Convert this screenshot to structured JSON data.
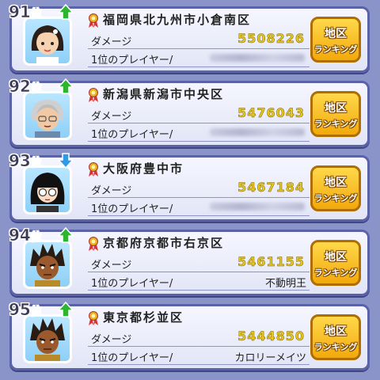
{
  "colors": {
    "trend_up": "#2db52d",
    "trend_down": "#2e9be6",
    "score": "#e8c81e",
    "button": "#f5b918"
  },
  "labels": {
    "damage": "ダメージ",
    "first_player": "1位のプレイヤー/",
    "button_line1": "地区",
    "button_line2": "ランキング",
    "rank_suffix": "位"
  },
  "rows": [
    {
      "rank": "91",
      "trend": "up",
      "trend_icon": "arrow-up-icon",
      "region": "福岡県北九州市小倉南区",
      "damage": "5508226",
      "player": "",
      "player_blurred": true,
      "avatar_icon": "girl-avatar-icon"
    },
    {
      "rank": "92",
      "trend": "up",
      "trend_icon": "arrow-up-icon",
      "region": "新潟県新潟市中央区",
      "damage": "5476043",
      "player": "",
      "player_blurred": true,
      "avatar_icon": "old-man-avatar-icon"
    },
    {
      "rank": "93",
      "trend": "down",
      "trend_icon": "arrow-down-icon",
      "region": "大阪府豊中市",
      "damage": "5467184",
      "player": "",
      "player_blurred": true,
      "avatar_icon": "glasses-girl-avatar-icon"
    },
    {
      "rank": "94",
      "trend": "up",
      "trend_icon": "arrow-up-icon",
      "region": "京都府京都市右京区",
      "damage": "5461155",
      "player": "不動明王",
      "player_blurred": false,
      "avatar_icon": "spiky-hair-avatar-icon"
    },
    {
      "rank": "95",
      "trend": "up",
      "trend_icon": "arrow-up-icon",
      "region": "東京都杉並区",
      "damage": "5444850",
      "player": "カロリーメイツ",
      "player_blurred": false,
      "avatar_icon": "spiky-hair-avatar-icon"
    }
  ]
}
